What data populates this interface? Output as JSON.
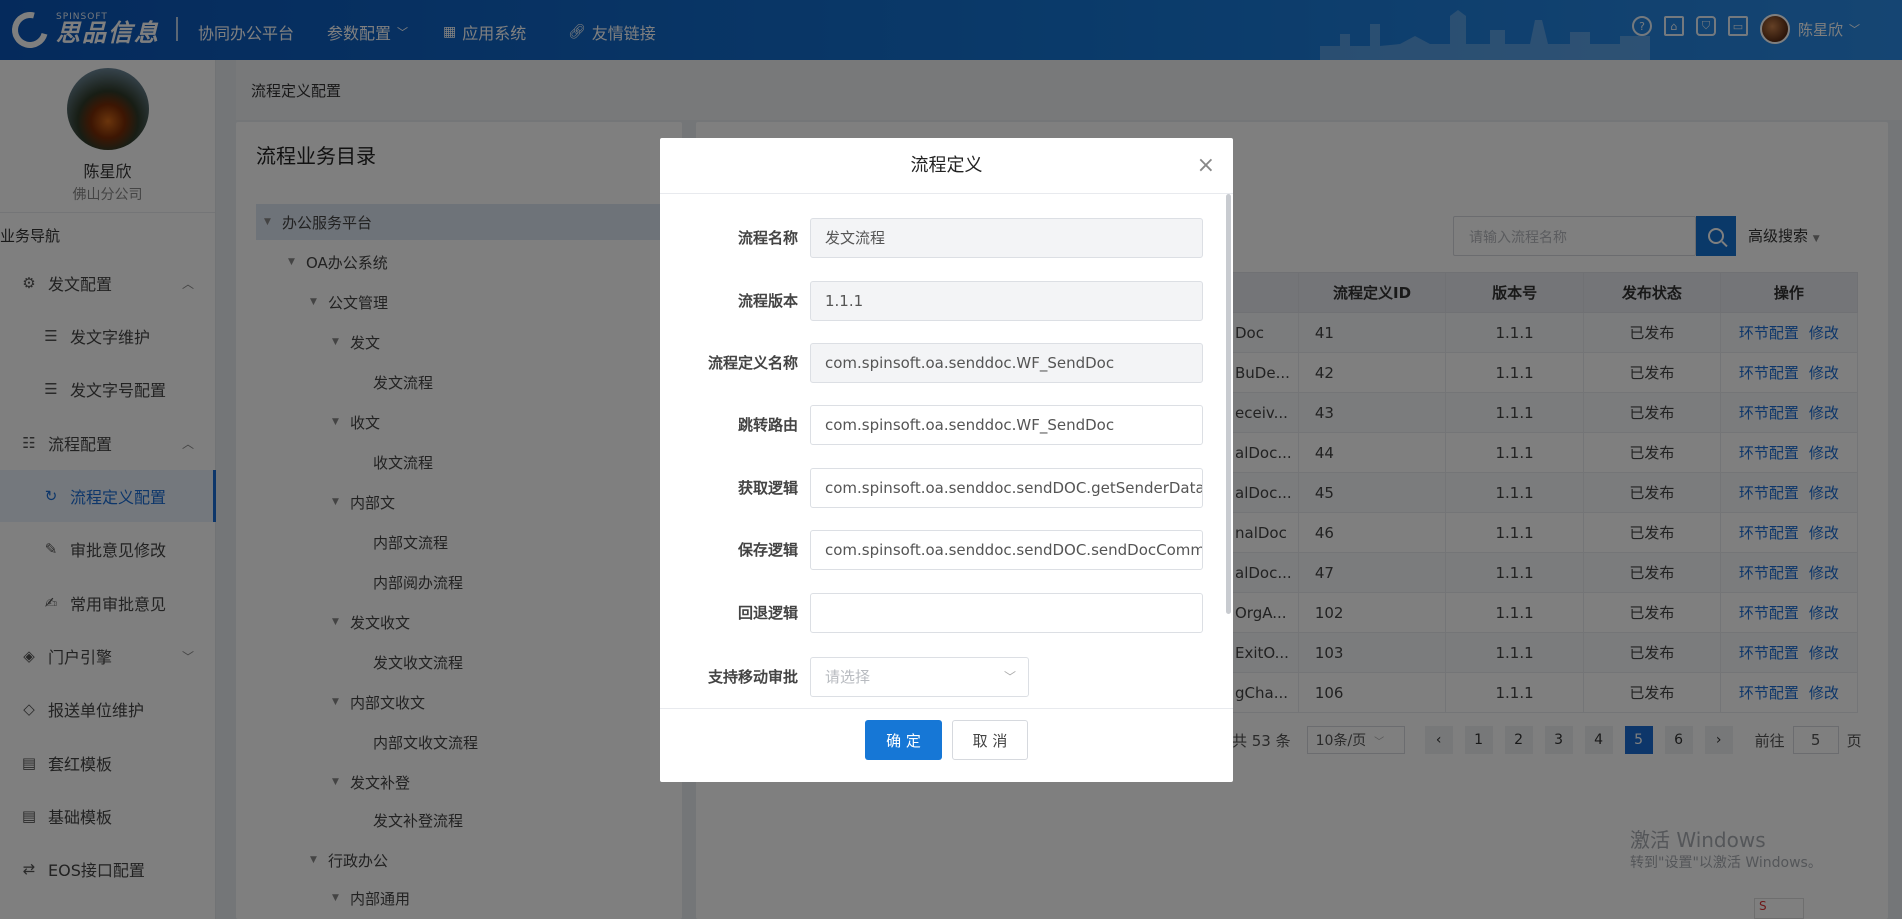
{
  "topbar": {
    "brand_en": "SPINSOFT",
    "brand": "思品信息",
    "platform": "协同办公平台",
    "nav": [
      "参数配置",
      "应用系统",
      "友情链接"
    ],
    "username": "陈星欣"
  },
  "sidebar": {
    "user_name": "陈星欣",
    "user_org": "佛山分公司",
    "section": "业务导航",
    "items": [
      {
        "label": "发文配置",
        "icon": "document-settings-icon",
        "expanded": true
      },
      {
        "label": "发文字维护",
        "icon": "file-list-icon"
      },
      {
        "label": "发文字号配置",
        "icon": "file-list-icon"
      },
      {
        "label": "流程配置",
        "icon": "sliders-icon",
        "expanded": true
      },
      {
        "label": "流程定义配置",
        "icon": "refresh-cycle-icon",
        "active": true
      },
      {
        "label": "审批意见修改",
        "icon": "pen-icon"
      },
      {
        "label": "常用审批意见",
        "icon": "edit-doc-icon"
      },
      {
        "label": "门户引擎",
        "icon": "layers-icon"
      },
      {
        "label": "报送单位维护",
        "icon": "layers-icon"
      },
      {
        "label": "套红模板",
        "icon": "template-icon"
      },
      {
        "label": "基础模板",
        "icon": "template-icon"
      },
      {
        "label": "EOS接口配置",
        "icon": "swap-arrows-icon"
      }
    ]
  },
  "breadcrumb": "流程定义配置",
  "tree": {
    "title": "流程业务目录",
    "nodes": [
      "办公服务平台",
      "OA办公系统",
      "公文管理",
      "发文",
      "发文流程",
      "收文",
      "收文流程",
      "内部文",
      "内部文流程",
      "内部阅办流程",
      "发文收文",
      "发文收文流程",
      "内部文收文",
      "内部文收文流程",
      "发文补登",
      "发文补登流程",
      "行政办公",
      "内部通用"
    ]
  },
  "list": {
    "search_placeholder": "请输入流程名称",
    "advanced": "高级搜索",
    "columns": [
      "流程定义ID",
      "版本号",
      "发布状态",
      "操作"
    ],
    "rows": [
      {
        "name": "Doc",
        "id": "41",
        "ver": "1.1.1",
        "status": "已发布"
      },
      {
        "name": "BuDe...",
        "id": "42",
        "ver": "1.1.1",
        "status": "已发布"
      },
      {
        "name": "eceiv...",
        "id": "43",
        "ver": "1.1.1",
        "status": "已发布"
      },
      {
        "name": "alDoc...",
        "id": "44",
        "ver": "1.1.1",
        "status": "已发布"
      },
      {
        "name": "alDoc...",
        "id": "45",
        "ver": "1.1.1",
        "status": "已发布"
      },
      {
        "name": "nalDoc",
        "id": "46",
        "ver": "1.1.1",
        "status": "已发布"
      },
      {
        "name": "alDoc...",
        "id": "47",
        "ver": "1.1.1",
        "status": "已发布"
      },
      {
        "name": "OrgA...",
        "id": "102",
        "ver": "1.1.1",
        "status": "已发布"
      },
      {
        "name": "ExitO...",
        "id": "103",
        "ver": "1.1.1",
        "status": "已发布"
      },
      {
        "name": "gCha...",
        "id": "106",
        "ver": "1.1.1",
        "status": "已发布"
      }
    ],
    "action_config": "环节配置",
    "action_edit": "修改",
    "pager": {
      "total": "共 53 条",
      "page_size": "10条/页",
      "pages": [
        "1",
        "2",
        "3",
        "4",
        "5",
        "6"
      ],
      "current": "5",
      "goto_label": "前往",
      "goto_value": "5",
      "goto_suffix": "页"
    }
  },
  "watermark": {
    "line1": "激活 Windows",
    "line2": "转到\"设置\"以激活 Windows。"
  },
  "tray": "S",
  "dialog": {
    "title": "流程定义",
    "fields": [
      {
        "label": "流程名称",
        "value": "发文流程",
        "readonly": true
      },
      {
        "label": "流程版本",
        "value": "1.1.1",
        "readonly": true
      },
      {
        "label": "流程定义名称",
        "value": "com.spinsoft.oa.senddoc.WF_SendDoc",
        "readonly": true
      },
      {
        "label": "跳转路由",
        "value": "com.spinsoft.oa.senddoc.WF_SendDoc",
        "readonly": false
      },
      {
        "label": "获取逻辑",
        "value": "com.spinsoft.oa.senddoc.sendDOC.getSenderData",
        "readonly": false
      },
      {
        "label": "保存逻辑",
        "value": "com.spinsoft.oa.senddoc.sendDOC.sendDocComm",
        "readonly": false
      },
      {
        "label": "回退逻辑",
        "value": "",
        "readonly": false
      }
    ],
    "mobile_label": "支持移动审批",
    "mobile_placeholder": "请选择",
    "ok": "确 定",
    "cancel": "取 消"
  }
}
